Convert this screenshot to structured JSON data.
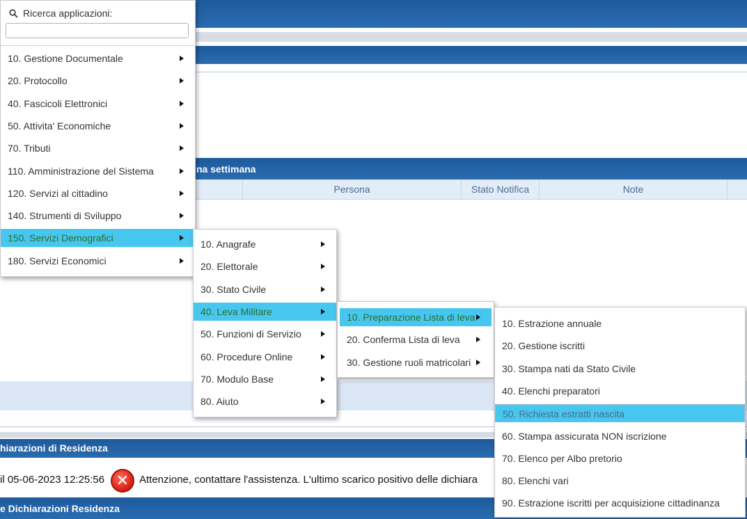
{
  "background": {
    "section_titles": {
      "week": "na settimana",
      "residenza": "hiarazioni di Residenza",
      "dich_residenza": "e Dichiarazioni Residenza"
    },
    "grid_columns": [
      "Persona",
      "Stato Notifica",
      "Note"
    ],
    "message": {
      "date_text": "il 05-06-2023 12:25:56",
      "warning_text": "Attenzione, contattare l'assistenza. L'ultimo scarico positivo delle dichiara"
    }
  },
  "search": {
    "label": "Ricerca applicazioni:",
    "value": "",
    "placeholder": ""
  },
  "menu_main": [
    {
      "label": "10. Gestione Documentale",
      "has_sub": true
    },
    {
      "label": "20. Protocollo",
      "has_sub": true
    },
    {
      "label": "40. Fascicoli Elettronici",
      "has_sub": true
    },
    {
      "label": "50. Attivita' Economiche",
      "has_sub": true
    },
    {
      "label": "70. Tributi",
      "has_sub": true
    },
    {
      "label": "110. Amministrazione del Sistema",
      "has_sub": true
    },
    {
      "label": "120. Servizi al cittadino",
      "has_sub": true
    },
    {
      "label": "140. Strumenti di Sviluppo",
      "has_sub": true
    },
    {
      "label": "150. Servizi Demografici",
      "has_sub": true,
      "active": true
    },
    {
      "label": "180. Servizi Economici",
      "has_sub": true
    }
  ],
  "menu_demografici": [
    {
      "label": "10. Anagrafe",
      "has_sub": true
    },
    {
      "label": "20. Elettorale",
      "has_sub": true
    },
    {
      "label": "30. Stato Civile",
      "has_sub": true
    },
    {
      "label": "40. Leva Militare",
      "has_sub": true,
      "active": true
    },
    {
      "label": "50. Funzioni di Servizio",
      "has_sub": true
    },
    {
      "label": "60. Procedure Online",
      "has_sub": true
    },
    {
      "label": "70. Modulo Base",
      "has_sub": true
    },
    {
      "label": "80. Aiuto",
      "has_sub": true
    }
  ],
  "menu_leva": [
    {
      "label": "10. Preparazione Lista di leva",
      "has_sub": true,
      "active": true
    },
    {
      "label": "20. Conferma Lista di leva",
      "has_sub": true
    },
    {
      "label": "30. Gestione ruoli matricolari",
      "has_sub": true
    }
  ],
  "menu_preparazione": [
    {
      "label": "10. Estrazione annuale"
    },
    {
      "label": "20. Gestione iscritti"
    },
    {
      "label": "30. Stampa nati da Stato Civile"
    },
    {
      "label": "40. Elenchi preparatori"
    },
    {
      "label": "50. Richiesta estratti nascita",
      "hover": true
    },
    {
      "label": "60. Stampa assicurata NON iscrizione"
    },
    {
      "label": "70. Elenco per Albo pretorio"
    },
    {
      "label": "80. Elenchi vari"
    },
    {
      "label": "90. Estrazione iscritti per acquisizione cittadinanza"
    }
  ],
  "colors": {
    "header_band": "#1d5a9c",
    "menu_active": "#47c7ef",
    "error_icon": "#d41e12"
  }
}
